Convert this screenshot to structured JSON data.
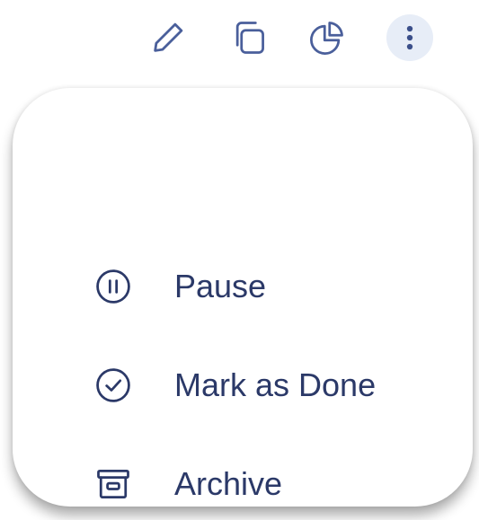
{
  "toolbar": {
    "icons": [
      "pencil-icon",
      "copy-icon",
      "pie-chart-icon",
      "more-vertical-icon"
    ],
    "icon_color": "#4a5f9b",
    "active_bg": "#e7edf7"
  },
  "menu": {
    "items": [
      {
        "label": "Pause",
        "icon": "pause-circle-icon"
      },
      {
        "label": "Mark as Done",
        "icon": "check-circle-icon"
      },
      {
        "label": "Archive",
        "icon": "archive-box-icon"
      }
    ],
    "text_color": "#2b3968"
  }
}
